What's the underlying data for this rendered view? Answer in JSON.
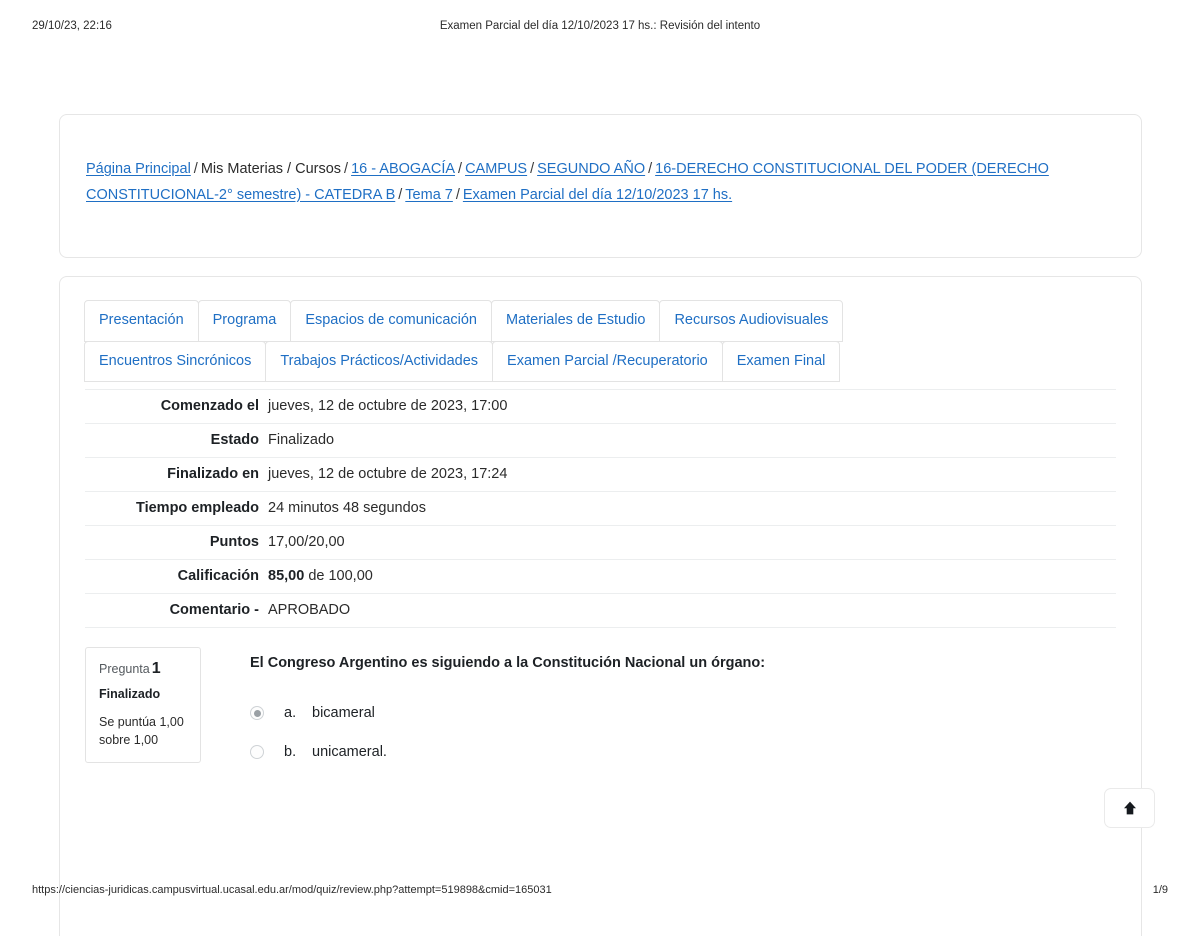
{
  "print_header": {
    "left": "29/10/23, 22:16",
    "center": "Examen Parcial del día 12/10/2023 17 hs.: Revisión del intento"
  },
  "print_footer": {
    "url": "https://ciencias-juridicas.campusvirtual.ucasal.edu.ar/mod/quiz/review.php?attempt=519898&cmid=165031",
    "page": "1/9"
  },
  "breadcrumb": {
    "items": [
      {
        "label": "Página Principal",
        "link": true
      },
      {
        "label": "Mis Materias / Cursos",
        "link": false
      },
      {
        "label": "16 - ABOGACÍA",
        "link": true
      },
      {
        "label": "CAMPUS",
        "link": true
      },
      {
        "label": "SEGUNDO AÑO",
        "link": true
      },
      {
        "label": "16-DERECHO CONSTITUCIONAL DEL PODER (DERECHO CONSTITUCIONAL-2° semestre) - CATEDRA B",
        "link": true
      },
      {
        "label": "Tema 7",
        "link": true
      },
      {
        "label": "Examen Parcial del día 12/10/2023 17 hs.",
        "link": true
      }
    ],
    "separator": "/"
  },
  "tabs": {
    "row1": [
      "Presentación",
      "Programa",
      "Espacios de comunicación",
      "Materiales de Estudio",
      "Recursos Audiovisuales"
    ],
    "row2": [
      "Encuentros Sincrónicos",
      "Trabajos Prácticos/Actividades",
      "Examen Parcial /Recuperatorio",
      "Examen Final"
    ]
  },
  "summary": {
    "rows": [
      {
        "label": "Comenzado el",
        "value": "jueves, 12 de octubre de 2023, 17:00"
      },
      {
        "label": "Estado",
        "value": "Finalizado"
      },
      {
        "label": "Finalizado en",
        "value": "jueves, 12 de octubre de 2023, 17:24"
      },
      {
        "label": "Tiempo empleado",
        "value": "24 minutos 48 segundos"
      },
      {
        "label": "Puntos",
        "value": "17,00/20,00"
      },
      {
        "label": "Calificación",
        "value_bold": "85,00",
        "value": " de 100,00"
      },
      {
        "label": "Comentario -",
        "value": "APROBADO"
      }
    ]
  },
  "question": {
    "info": {
      "number_label": "Pregunta",
      "number": "1",
      "state": "Finalizado",
      "grade": "Se puntúa 1,00 sobre 1,00"
    },
    "text": "El Congreso Argentino es siguiendo a la Constitución Nacional un órgano:",
    "answers": [
      {
        "letter": "a.",
        "text": "bicameral",
        "selected": true
      },
      {
        "letter": "b.",
        "text": "unicameral.",
        "selected": false
      }
    ]
  },
  "scroll_top": {
    "icon": "arrow-up-icon"
  },
  "colors": {
    "link": "#1f6fc4",
    "text": "#1d2125",
    "border": "#e6e6e6",
    "row_divider": "#eceeef"
  }
}
